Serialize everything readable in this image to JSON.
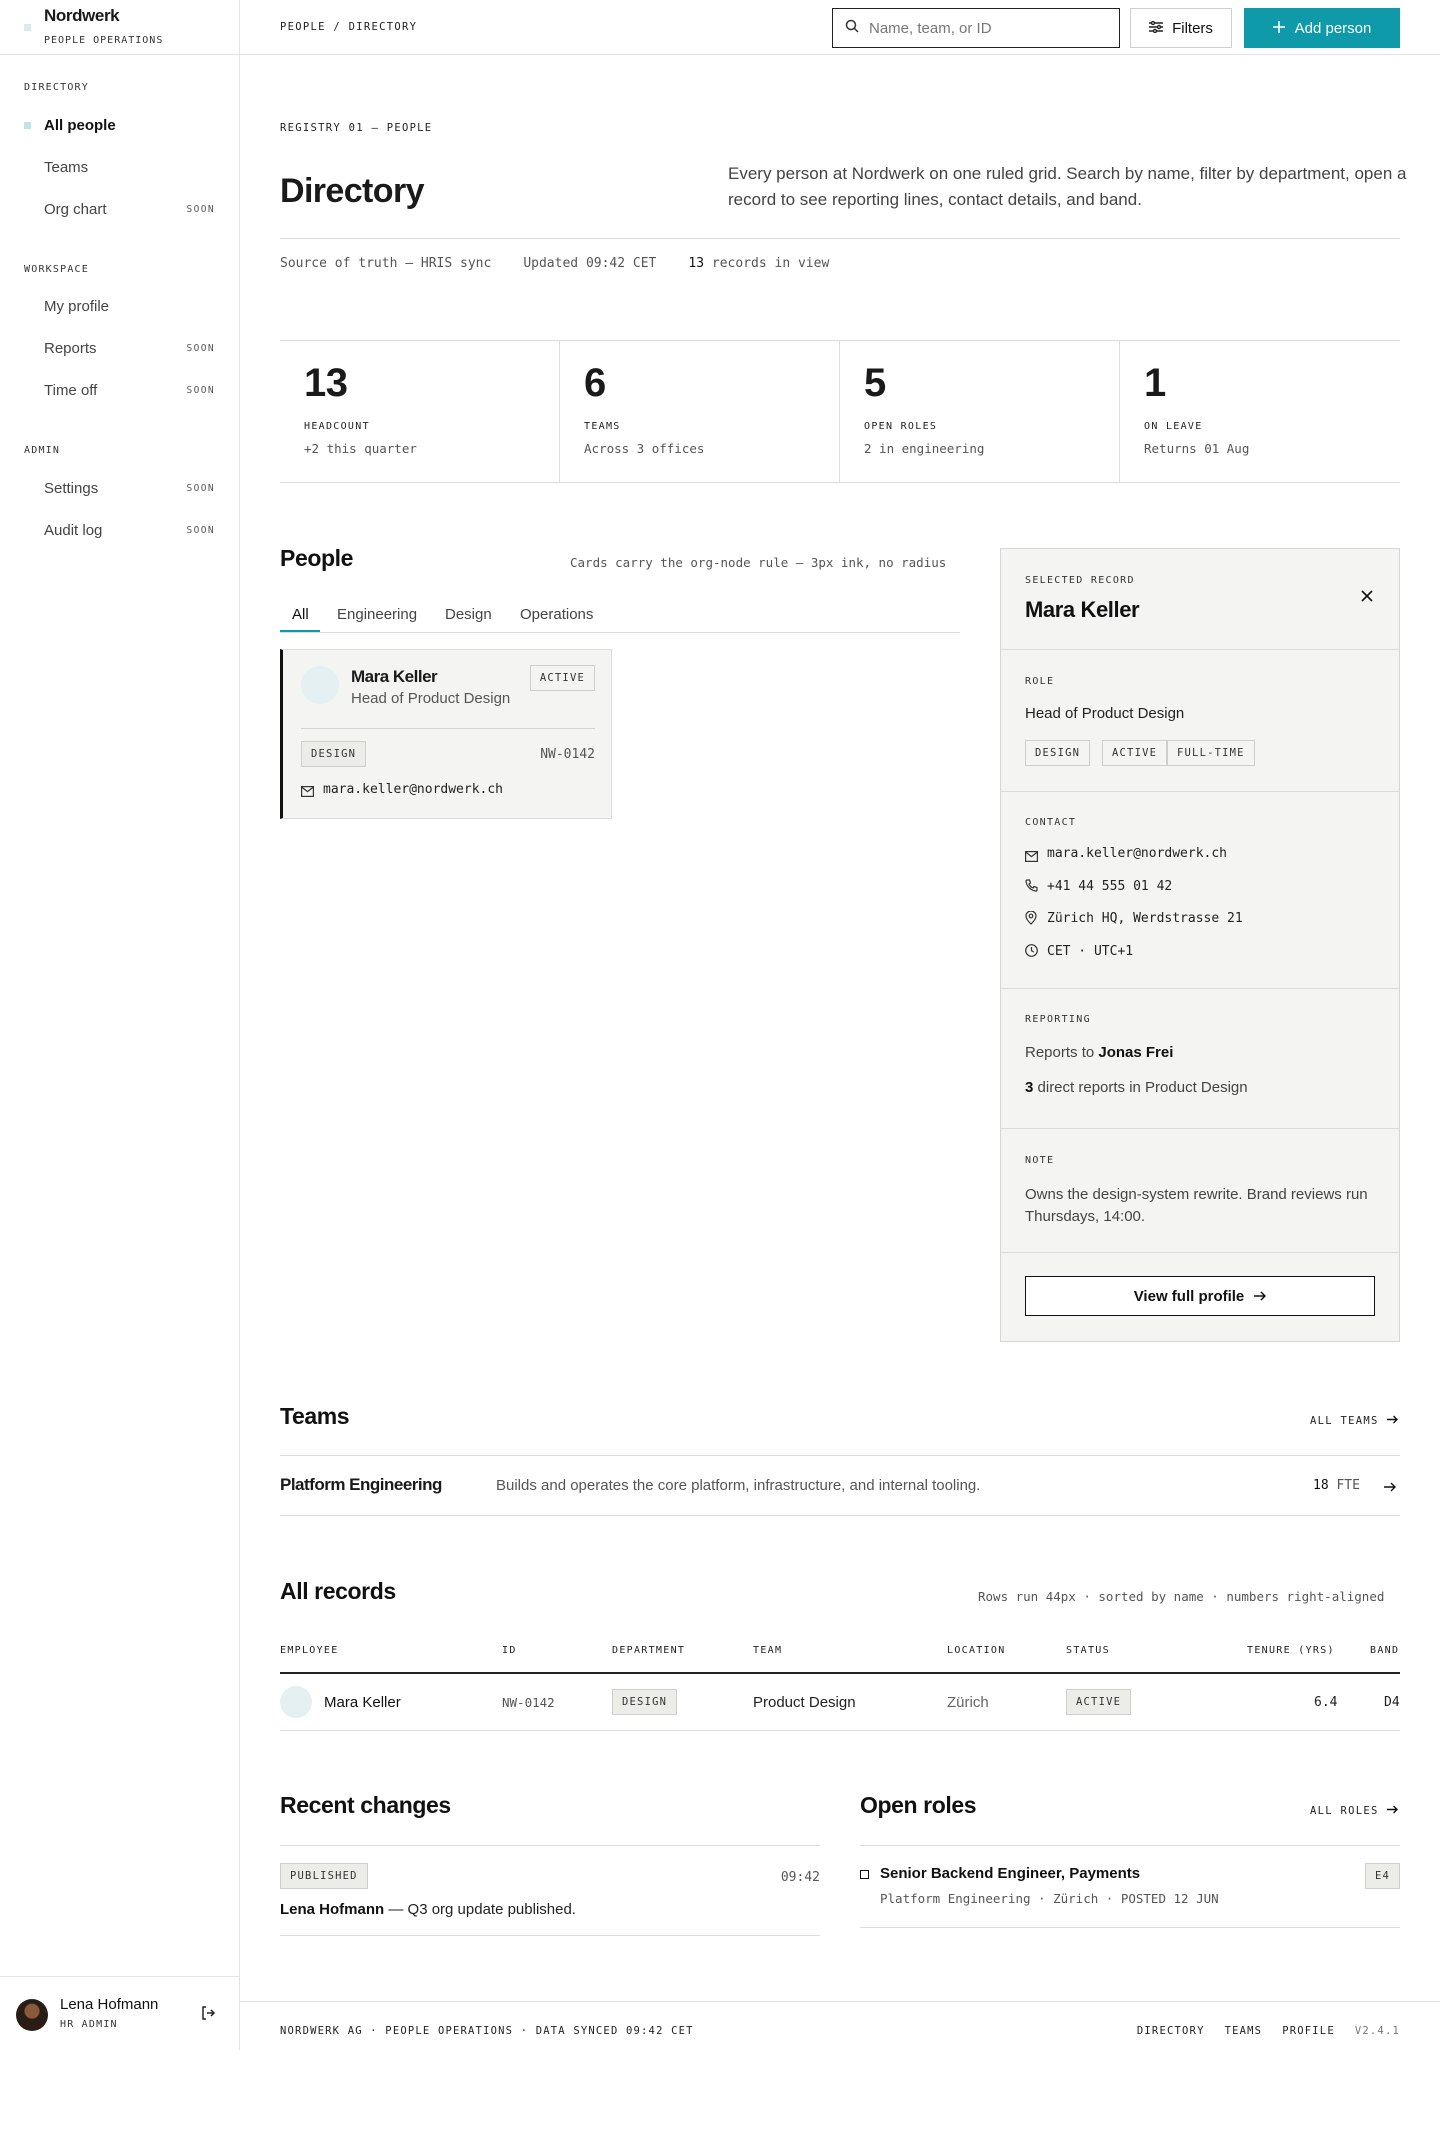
{
  "brand": {
    "name": "Nordwerk",
    "subtitle": "PEOPLE OPERATIONS"
  },
  "sidebar": {
    "sections": [
      {
        "label": "DIRECTORY",
        "items": [
          {
            "label": "All people",
            "active": true,
            "badge": ""
          },
          {
            "label": "Teams",
            "active": false,
            "badge": ""
          },
          {
            "label": "Org chart",
            "active": false,
            "badge": "SOON"
          }
        ]
      },
      {
        "label": "WORKSPACE",
        "items": [
          {
            "label": "My profile",
            "active": false,
            "badge": ""
          },
          {
            "label": "Reports",
            "active": false,
            "badge": "SOON"
          },
          {
            "label": "Time off",
            "active": false,
            "badge": "SOON"
          }
        ]
      },
      {
        "label": "ADMIN",
        "items": [
          {
            "label": "Settings",
            "active": false,
            "badge": "SOON"
          },
          {
            "label": "Audit log",
            "active": false,
            "badge": "SOON"
          }
        ]
      }
    ],
    "user": {
      "name": "Lena Hofmann",
      "role": "HR ADMIN"
    }
  },
  "topbar": {
    "breadcrumb": "PEOPLE / DIRECTORY",
    "search_placeholder": "Name, team, or ID",
    "filters_label": "Filters",
    "add_label": "Add person"
  },
  "header": {
    "kicker": "REGISTRY 01 — PEOPLE",
    "title": "Directory",
    "intro": "Every person at Nordwerk on one ruled grid. Search by name, filter by department, open a record to see reporting lines, contact details, and band.",
    "meta_source": "Source of truth — HRIS sync",
    "meta_updated": "Updated 09:42 CET",
    "meta_count": "13",
    "meta_count_label": "records in view"
  },
  "stats": [
    {
      "value": "13",
      "label": "HEADCOUNT",
      "sub": "+2 this quarter"
    },
    {
      "value": "6",
      "label": "TEAMS",
      "sub": "Across 3 offices"
    },
    {
      "value": "5",
      "label": "OPEN ROLES",
      "sub": "2 in engineering"
    },
    {
      "value": "1",
      "label": "ON LEAVE",
      "sub": "Returns 01 Aug"
    }
  ],
  "people": {
    "title": "People",
    "note": "Cards carry the org-node rule — 3px ink, no radius",
    "tabs": [
      "All",
      "Engineering",
      "Design",
      "Operations"
    ],
    "card": {
      "name": "Mara Keller",
      "title": "Head of Product Design",
      "status": "ACTIVE",
      "department": "DESIGN",
      "id": "NW-0142",
      "email": "mara.keller@nordwerk.ch"
    }
  },
  "detail": {
    "kicker": "SELECTED RECORD",
    "name": "Mara Keller",
    "role_label": "ROLE",
    "role": "Head of Product Design",
    "tags": [
      "DESIGN",
      "ACTIVE",
      "FULL-TIME"
    ],
    "contact_label": "CONTACT",
    "email": "mara.keller@nordwerk.ch",
    "phone": "+41 44 555 01 42",
    "location": "Zürich HQ, Werdstrasse 21",
    "timezone": "CET · UTC+1",
    "reporting_label": "REPORTING",
    "reports_to_prefix": "Reports to",
    "reports_to": "Jonas Frei",
    "direct_count": "3",
    "direct_suffix": "direct reports in Product Design",
    "note_label": "NOTE",
    "note": "Owns the design-system rewrite. Brand reviews run Thursdays, 14:00.",
    "view_label": "View full profile"
  },
  "teams": {
    "title": "Teams",
    "all_label": "ALL TEAMS",
    "rows": [
      {
        "name": "Platform Engineering",
        "desc": "Builds and operates the core platform, infrastructure, and internal tooling.",
        "fte": "18",
        "fte_unit": "FTE"
      }
    ]
  },
  "records": {
    "title": "All records",
    "note": "Rows run 44px · sorted by name · numbers right-aligned",
    "columns": [
      "EMPLOYEE",
      "ID",
      "DEPARTMENT",
      "TEAM",
      "LOCATION",
      "STATUS",
      "TENURE (YRS)",
      "BAND"
    ],
    "rows": [
      {
        "name": "Mara Keller",
        "id": "NW-0142",
        "department": "DESIGN",
        "team": "Product Design",
        "location": "Zürich",
        "status": "ACTIVE",
        "tenure": "6.4",
        "band": "D4"
      }
    ]
  },
  "recent": {
    "title": "Recent changes",
    "items": [
      {
        "tag": "PUBLISHED",
        "time": "09:42",
        "actor": "Lena Hofmann",
        "text": " — Q3 org update published."
      }
    ]
  },
  "open_roles": {
    "title": "Open roles",
    "all_label": "ALL ROLES",
    "items": [
      {
        "title": "Senior Backend Engineer, Payments",
        "meta": "Platform Engineering · Zürich · POSTED 12 JUN",
        "band": "E4"
      }
    ]
  },
  "footer": {
    "left": "NORDWERK AG · PEOPLE OPERATIONS · DATA SYNCED 09:42 CET",
    "links": [
      "DIRECTORY",
      "TEAMS",
      "PROFILE"
    ],
    "version": "V2.4.1"
  },
  "colors": {
    "accent": "#0f9aaa",
    "ink": "#111111",
    "panel": "#f4f4f2",
    "rule": "#dcdcdc"
  }
}
